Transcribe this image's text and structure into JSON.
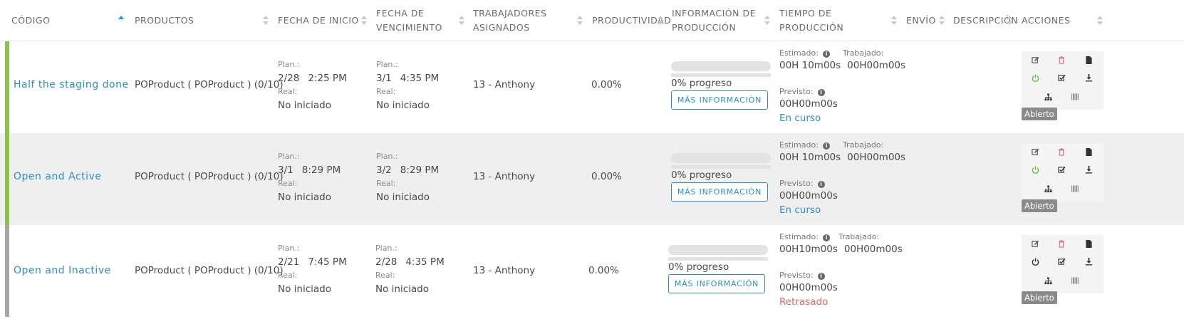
{
  "columns": [
    {
      "key": "code",
      "label": "CÓDIGO"
    },
    {
      "key": "products",
      "label": "PRODUCTOS"
    },
    {
      "key": "start",
      "label": "FECHA DE INICIO"
    },
    {
      "key": "due",
      "label": "FECHA DE VENCIMIENTO"
    },
    {
      "key": "workers",
      "label": "TRABAJADORES ASIGNADOS"
    },
    {
      "key": "productivity",
      "label": "PRODUCTIVIDAD"
    },
    {
      "key": "info",
      "label": "INFORMACIÓN DE PRODUCCIÓN"
    },
    {
      "key": "time",
      "label": "TIEMPO DE PRODUCCIÓN"
    },
    {
      "key": "shipping",
      "label": "ENVÍO"
    },
    {
      "key": "description",
      "label": "DESCRIPCIÓN"
    },
    {
      "key": "actions",
      "label": "ACCIONES"
    }
  ],
  "sorted_column": "code",
  "labels": {
    "plan": "Plan.:",
    "real": "Real:",
    "estimated": "Estimado:",
    "worked": "Trabajado:",
    "forecast": "Previsto:",
    "more_info": "MÁS INFORMACIÓN"
  },
  "icons": [
    "edit-icon",
    "delete-icon",
    "file-icon",
    "power-icon",
    "checklist-icon",
    "download-icon",
    "hierarchy-icon",
    "barcode-icon"
  ],
  "colors": {
    "active": "#8dc14a",
    "inactive": "#a6a6a6",
    "link": "#2a8fd0",
    "delete": "#e06464",
    "power_on": "#6cbf3e",
    "late": "#e06464"
  },
  "rows": [
    {
      "code": "Half the staging done",
      "product": "POProduct ( POProduct ) (0/10)",
      "start_date": "2/28",
      "start_time": "2:25 PM",
      "start_real": "No iniciado",
      "due_date": "3/1",
      "due_time": "4:35 PM",
      "due_real": "No iniciado",
      "workers": "13 - Anthony",
      "productivity": "0.00%",
      "progress_pct": 0,
      "progress_text": "0% progreso",
      "estimated": "00H 10m00s",
      "worked": "00H00m00s",
      "forecast": "00H00m00s",
      "status": "En curso",
      "status_type": "ok",
      "state": "Abierto",
      "active": true
    },
    {
      "code": "Open and Active",
      "product": "POProduct ( POProduct ) (0/10)",
      "start_date": "3/1",
      "start_time": "8:29 PM",
      "start_real": "No iniciado",
      "due_date": "3/2",
      "due_time": "8:29 PM",
      "due_real": "No iniciado",
      "workers": "13 - Anthony",
      "productivity": "0.00%",
      "progress_pct": 0,
      "progress_text": "0% progreso",
      "estimated": "00H 10m00s",
      "worked": "00H00m00s",
      "forecast": "00H00m00s",
      "status": "En curso",
      "status_type": "ok",
      "state": "Abierto",
      "active": true
    },
    {
      "code": "Open and Inactive",
      "product": "POProduct ( POProduct ) (0/10)",
      "start_date": "2/21",
      "start_time": "7:45 PM",
      "start_real": "No iniciado",
      "due_date": "2/28",
      "due_time": "4:35 PM",
      "due_real": "No iniciado",
      "workers": "13 - Anthony",
      "productivity": "0.00%",
      "progress_pct": 0,
      "progress_text": "0% progreso",
      "estimated": "00H10m00s",
      "worked": "00H00m00s",
      "forecast": "00H00m00s",
      "status": "Retrasado",
      "status_type": "late",
      "state": "Abierto",
      "active": false
    }
  ]
}
